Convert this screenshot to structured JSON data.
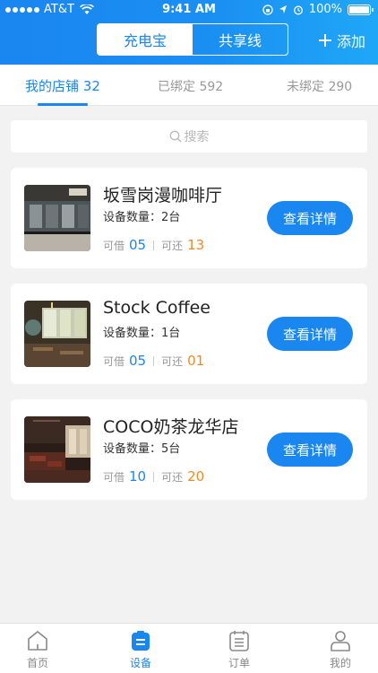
{
  "status_bar": {
    "carrier": "AT&T",
    "time": "9:41 AM",
    "battery": "100%"
  },
  "header": {
    "segments": [
      "充电宝",
      "共享线"
    ],
    "active_segment": 0,
    "add_label": "添加"
  },
  "tabs": [
    {
      "label": "我的店铺",
      "count": "32"
    },
    {
      "label": "已绑定",
      "count": "592"
    },
    {
      "label": "未绑定",
      "count": "290"
    }
  ],
  "search": {
    "placeholder": "搜索"
  },
  "stores": [
    {
      "name": "坂雪岗漫咖啡厅",
      "device_label": "设备数量：2台",
      "borrow_label": "可借",
      "borrow": "05",
      "return_label": "可还",
      "return": "13",
      "button": "查看详情"
    },
    {
      "name": "Stock Coffee",
      "device_label": "设备数量：1台",
      "borrow_label": "可借",
      "borrow": "05",
      "return_label": "可还",
      "return": "01",
      "button": "查看详情"
    },
    {
      "name": "COCO奶茶龙华店",
      "device_label": "设备数量：5台",
      "borrow_label": "可借",
      "borrow": "10",
      "return_label": "可还",
      "return": "20",
      "button": "查看详情"
    }
  ],
  "bottom_nav": [
    {
      "label": "首页",
      "icon": "home-icon"
    },
    {
      "label": "设备",
      "icon": "device-icon"
    },
    {
      "label": "订单",
      "icon": "order-icon"
    },
    {
      "label": "我的",
      "icon": "profile-icon"
    }
  ],
  "colors": {
    "primary": "#1a86f0",
    "accent_orange": "#f08a24",
    "background": "#f2f2f2"
  }
}
